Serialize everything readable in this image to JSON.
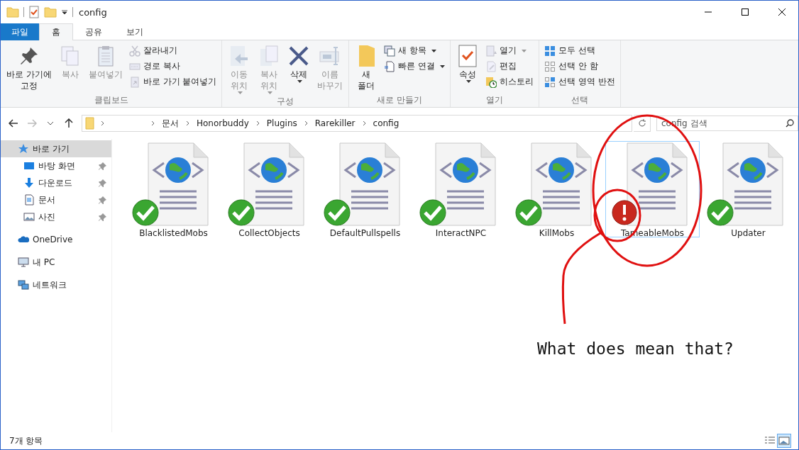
{
  "window": {
    "title": "config"
  },
  "ribbon_tabs": [
    {
      "label": "파일",
      "kind": "file",
      "selected": false
    },
    {
      "label": "홈",
      "kind": "tab",
      "selected": true
    },
    {
      "label": "공유",
      "kind": "tab",
      "selected": false
    },
    {
      "label": "보기",
      "kind": "tab",
      "selected": false
    }
  ],
  "ribbon_groups": [
    {
      "title": "클립보드",
      "buttons": [
        {
          "kind": "large",
          "label": "바로 가기에\n고정",
          "disabled": false
        },
        {
          "kind": "large",
          "label": "복사",
          "disabled": true
        },
        {
          "kind": "large",
          "label": "붙여넣기",
          "disabled": true
        },
        {
          "kind": "small",
          "label": "잘라내기",
          "disabled": true
        },
        {
          "kind": "small",
          "label": "경로 복사",
          "disabled": true
        },
        {
          "kind": "small",
          "label": "바로 가기 붙여넣기",
          "disabled": true
        }
      ]
    },
    {
      "title": "구성",
      "buttons": [
        {
          "kind": "large",
          "label": "이동\n위치",
          "dropdown": true,
          "disabled": true
        },
        {
          "kind": "large",
          "label": "복사\n위치",
          "dropdown": true,
          "disabled": true
        },
        {
          "kind": "large",
          "label": "삭제",
          "dropdown": true,
          "disabled": false
        },
        {
          "kind": "large",
          "label": "이름\n바꾸기",
          "disabled": true
        }
      ]
    },
    {
      "title": "새로 만들기",
      "buttons": [
        {
          "kind": "large",
          "label": "새\n폴더",
          "disabled": false
        },
        {
          "kind": "small",
          "label": "새 항목",
          "dropdown": true,
          "disabled": false
        },
        {
          "kind": "small",
          "label": "빠른 연결",
          "dropdown": true,
          "disabled": false
        }
      ]
    },
    {
      "title": "열기",
      "buttons": [
        {
          "kind": "large",
          "label": "속성",
          "dropdown": true,
          "disabled": false
        },
        {
          "kind": "small",
          "label": "열기",
          "dropdown": true,
          "disabled": true
        },
        {
          "kind": "small",
          "label": "편집",
          "disabled": true
        },
        {
          "kind": "small",
          "label": "히스토리",
          "disabled": false
        }
      ]
    },
    {
      "title": "선택",
      "buttons": [
        {
          "kind": "small",
          "label": "모두 선택",
          "disabled": false
        },
        {
          "kind": "small",
          "label": "선택 안 함",
          "disabled": false
        },
        {
          "kind": "small",
          "label": "선택 영역 반전",
          "disabled": false
        }
      ]
    }
  ],
  "address_bar": {
    "path": [
      "문서",
      "Honorbuddy",
      "Plugins",
      "Rarekiller",
      "config"
    ]
  },
  "search": {
    "placeholder": "config 검색"
  },
  "sidebar": {
    "items": [
      {
        "label": "바로 가기",
        "selected": true,
        "children": [
          {
            "label": "바탕 화면",
            "pinned": true
          },
          {
            "label": "다운로드",
            "pinned": true
          },
          {
            "label": "문서",
            "pinned": true
          },
          {
            "label": "사진",
            "pinned": true
          }
        ]
      },
      {
        "label": "OneDrive",
        "selected": false
      },
      {
        "label": "내 PC",
        "selected": false
      },
      {
        "label": "네트워크",
        "selected": false
      }
    ]
  },
  "files": [
    {
      "name": "BlacklistedMobs",
      "kind": "ok",
      "selected": false
    },
    {
      "name": "CollectObjects",
      "kind": "ok",
      "selected": false
    },
    {
      "name": "DefaultPullspells",
      "kind": "ok",
      "selected": false
    },
    {
      "name": "InteractNPC",
      "kind": "ok",
      "selected": false
    },
    {
      "name": "KillMobs",
      "kind": "ok",
      "selected": false
    },
    {
      "name": "TameableMobs",
      "kind": "error",
      "selected": true
    },
    {
      "name": "Updater",
      "kind": "ok",
      "selected": false
    }
  ],
  "status_bar": {
    "count": "7개 항목",
    "views": [
      {
        "kind": "details",
        "selected": false
      },
      {
        "kind": "large-icons",
        "selected": true
      }
    ]
  },
  "annotation": {
    "text": "What does mean that?"
  }
}
